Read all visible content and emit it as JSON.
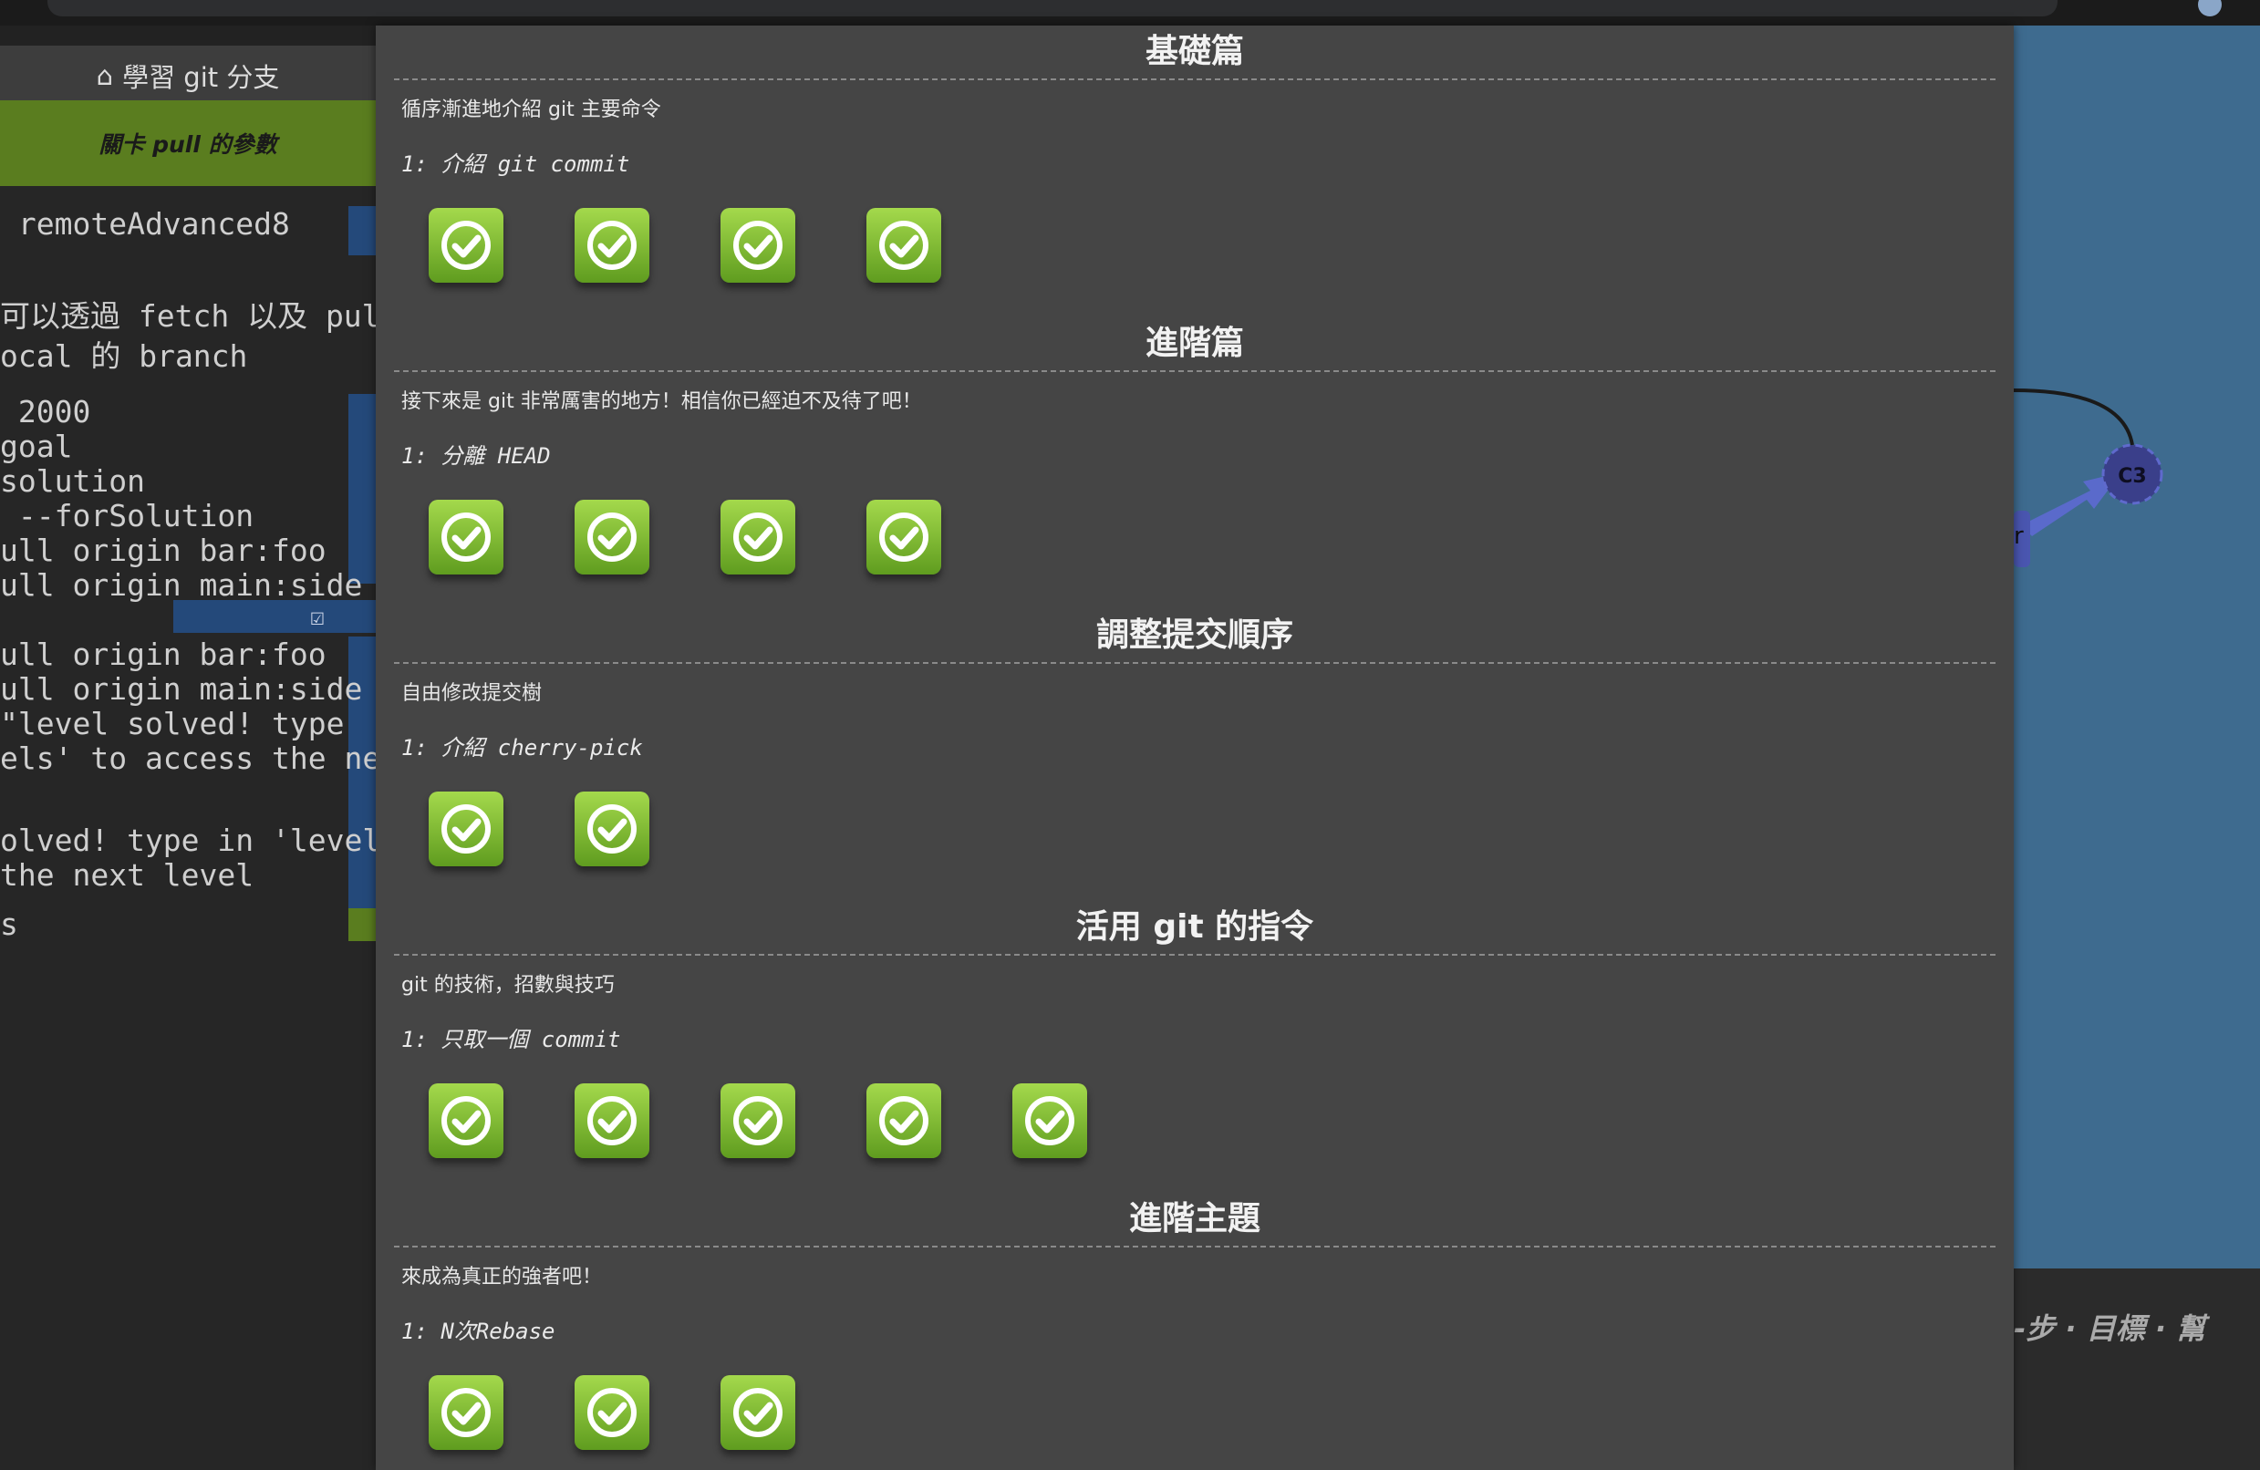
{
  "left_panel": {
    "home_label": "學習 git 分支",
    "level_label": "關卡 pull 的參數",
    "terminal_lines": [
      " remoteAdvanced8",
      "可以透過 fetch 以及 pull",
      "ocal 的 branch",
      " 2000",
      "goal",
      "solution",
      " --forSolution",
      "ull origin bar:foo",
      "ull origin main:side",
      "ull origin bar:foo",
      "ull origin main:side",
      "\"level solved! type",
      "els' to access the nex",
      "olved! type in 'levels",
      "the next level",
      "s"
    ]
  },
  "modal": {
    "sections": [
      {
        "title": "基礎篇",
        "description": "循序漸進地介紹 git 主要命令",
        "first_level": "1: 介紹 git commit",
        "solved_count": 4
      },
      {
        "title": "進階篇",
        "description": "接下來是 git 非常厲害的地方！相信你已經迫不及待了吧！",
        "first_level": "1: 分離 HEAD",
        "solved_count": 4
      },
      {
        "title": "調整提交順序",
        "description": "自由修改提交樹",
        "first_level": "1: 介紹 cherry-pick",
        "solved_count": 2
      },
      {
        "title": "活用 git 的指令",
        "description": "git 的技術，招數與技巧",
        "first_level": "1: 只取一個 commit",
        "solved_count": 5
      },
      {
        "title": "進階主題",
        "description": "來成為真正的強者吧！",
        "first_level": "1: N次Rebase",
        "solved_count": 3
      }
    ]
  },
  "right_panel": {
    "commit_node": "C3",
    "branch_fragment": "r",
    "nav_links": "-步 · 目標 · 幫"
  },
  "colors": {
    "modal_bg": "#454545",
    "level_green": "#7fbf2f",
    "viz_bg": "#3e6b8f",
    "commit_node": "#3a3f8a"
  }
}
